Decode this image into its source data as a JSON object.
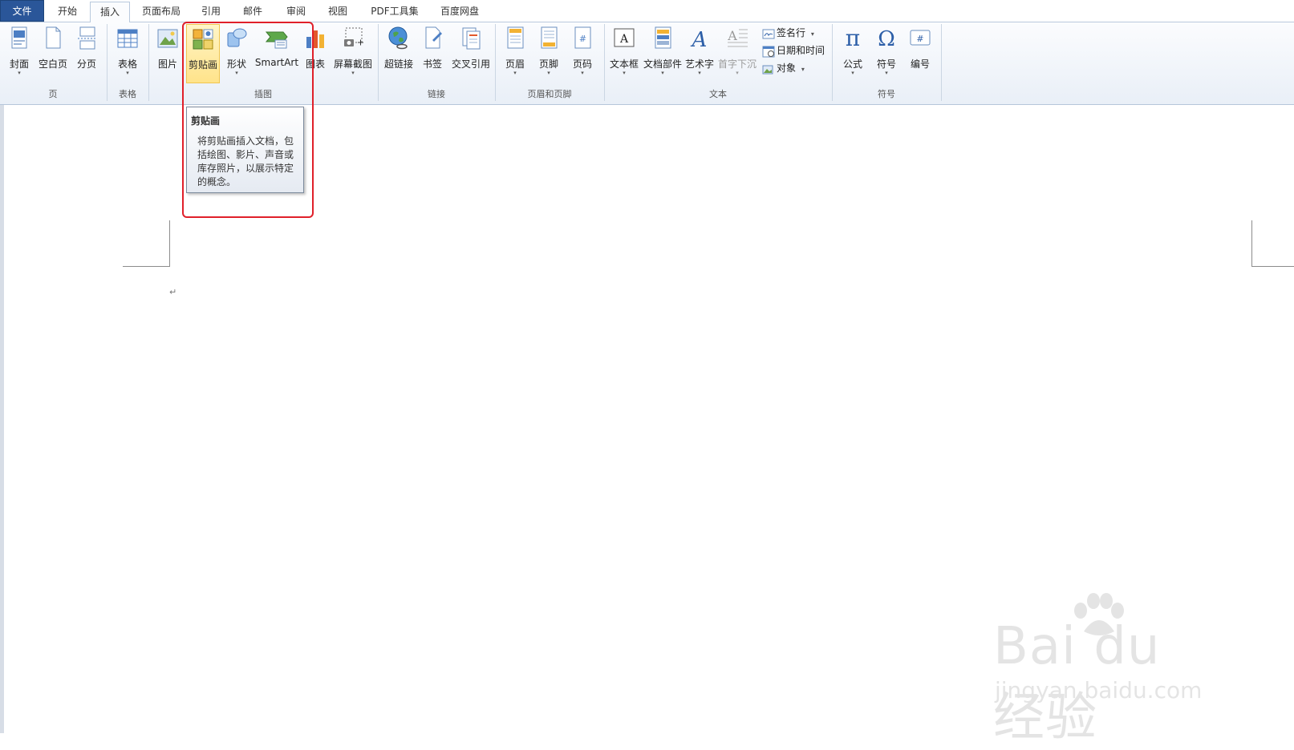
{
  "tabs": [
    {
      "label": "文件",
      "kind": "file"
    },
    {
      "label": "开始",
      "kind": ""
    },
    {
      "label": "插入",
      "kind": "active"
    },
    {
      "label": "页面布局",
      "kind": ""
    },
    {
      "label": "引用",
      "kind": ""
    },
    {
      "label": "邮件",
      "kind": ""
    },
    {
      "label": "审阅",
      "kind": ""
    },
    {
      "label": "视图",
      "kind": ""
    },
    {
      "label": "PDF工具集",
      "kind": ""
    },
    {
      "label": "百度网盘",
      "kind": ""
    }
  ],
  "ribbon": {
    "groups": {
      "page": "页",
      "table": "表格",
      "illustrations": "插图",
      "links": "链接",
      "header_footer": "页眉和页脚",
      "text": "文本",
      "symbols": "符号"
    },
    "buttons": {
      "cover": "封面",
      "blank_page": "空白页",
      "page_break": "分页",
      "table": "表格",
      "picture": "图片",
      "clipart": "剪贴画",
      "shapes": "形状",
      "smartart": "SmartArt",
      "chart": "图表",
      "screenshot": "屏幕截图",
      "hyperlink": "超链接",
      "bookmark": "书签",
      "cross_ref": "交叉引用",
      "header": "页眉",
      "footer": "页脚",
      "page_number": "页码",
      "textbox": "文本框",
      "quick_parts": "文档部件",
      "wordart": "艺术字",
      "dropcap": "首字下沉",
      "signature": "签名行",
      "datetime": "日期和时间",
      "object": "对象",
      "equation": "公式",
      "symbol": "符号",
      "numbering": "编号"
    },
    "dropdown_arrow": "▾"
  },
  "tooltip": {
    "title": "剪贴画",
    "lines": [
      "将剪贴画插入文档，包",
      "括绘图、影片、声音或",
      "库存照片，以展示特定",
      "的概念。"
    ]
  },
  "document": {
    "paragraph_mark": "↵"
  },
  "watermark": {
    "logo": "Bai du 经验",
    "url": "jingyan.baidu.com"
  },
  "colors": {
    "file_tab": "#2a5699",
    "highlight": "#ffe38a",
    "annotation": "#e0202a"
  }
}
